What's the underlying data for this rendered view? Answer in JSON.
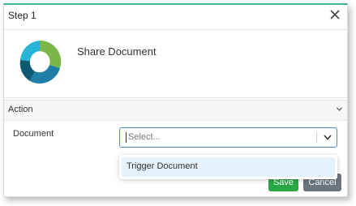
{
  "dialog": {
    "title": "Step 1",
    "close_icon": "close-icon"
  },
  "info": {
    "title": "Share Document",
    "logo_icon": "circular-arrows-logo",
    "logo_colors": [
      "#7ab648",
      "#1f7fa7",
      "#0c5b73",
      "#28b4d8"
    ]
  },
  "action": {
    "label": "Action",
    "chevron_icon": "chevron-down-icon"
  },
  "form": {
    "document_label": "Document",
    "document_placeholder": "Select...",
    "document_options": [
      "Trigger Document"
    ]
  },
  "buttons": {
    "save_label": "Save",
    "cancel_label": "Cancel"
  },
  "colors": {
    "accent_top": "#3db88b",
    "save": "#28a745",
    "cancel": "#6c757d",
    "select_focus": "#4a86c8",
    "option_highlight": "#e5f1fb"
  }
}
